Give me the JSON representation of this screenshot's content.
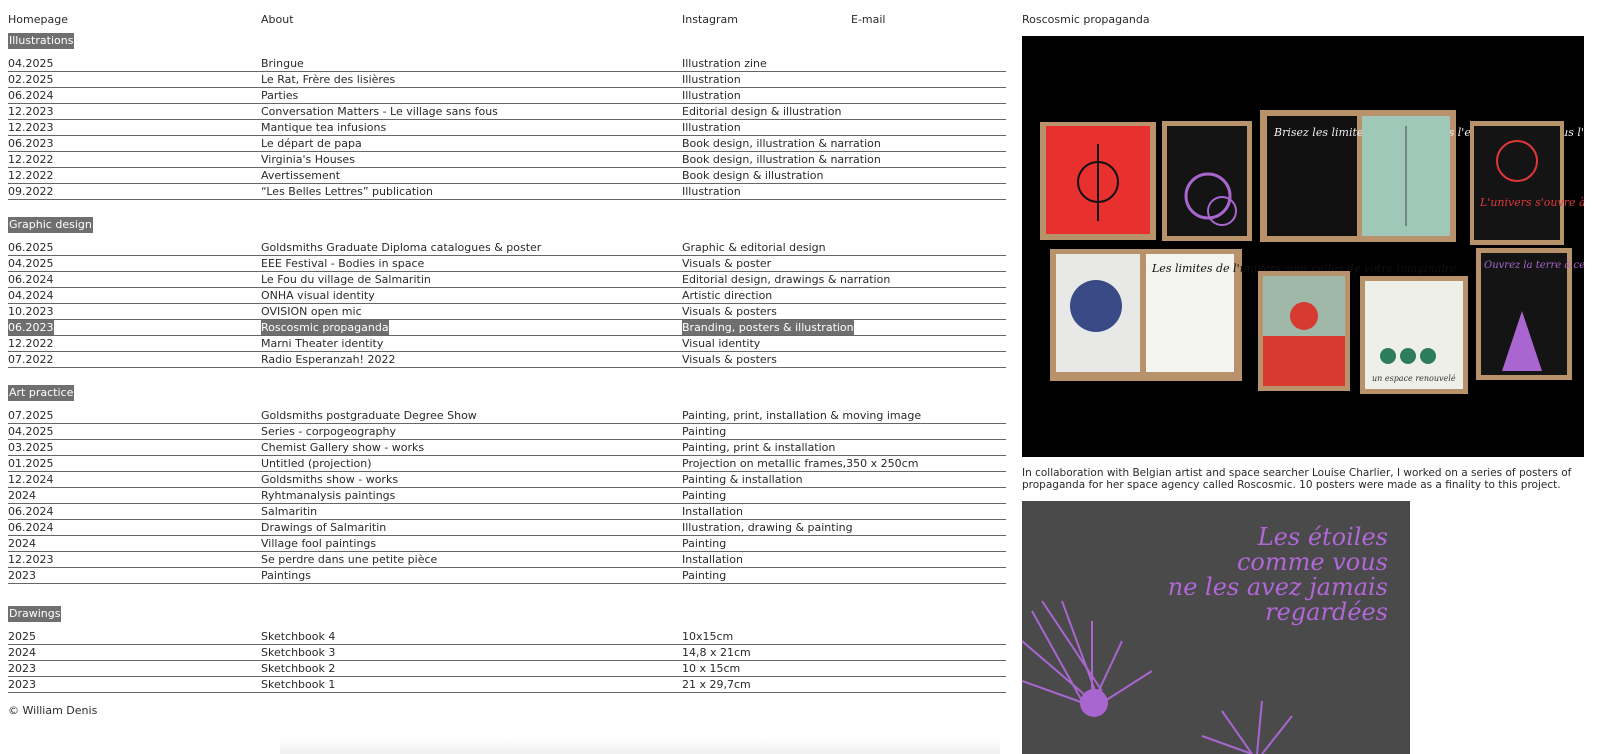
{
  "nav": {
    "homepage": "Homepage",
    "about": "About",
    "instagram": "Instagram",
    "email": "E-mail"
  },
  "right_title": "Roscosmic propaganda",
  "sections": {
    "illustrations": {
      "label": "Illustrations",
      "rows": [
        [
          "04.2025",
          "Bringue",
          "Illustration zine"
        ],
        [
          "02.2025",
          "Le Rat, Frère des lisières",
          "Illustration"
        ],
        [
          "06.2024",
          "Parties",
          "Illustration"
        ],
        [
          "12.2023",
          "Conversation Matters - Le village sans fous",
          "Editorial design & illustration"
        ],
        [
          "12.2023",
          "Mantique tea infusions",
          "Illustration"
        ],
        [
          "06.2023",
          "Le départ de papa",
          "Book design, illustration & narration"
        ],
        [
          "12.2022",
          "Virginia's Houses",
          "Book design, illustration & narration"
        ],
        [
          "12.2022",
          "Avertissement",
          "Book design & illustration"
        ],
        [
          "09.2022",
          "“Les Belles Lettres” publication",
          "Illustration"
        ]
      ]
    },
    "graphic_design": {
      "label": "Graphic design",
      "rows": [
        [
          "06.2025",
          "Goldsmiths Graduate Diploma  catalogues & poster",
          "Graphic & editorial design"
        ],
        [
          "04.2025",
          "EEE Festival - Bodies in space",
          "Visuals & poster"
        ],
        [
          "06.2024",
          "Le Fou du village de Salmaritin",
          "Editorial design, drawings & narration"
        ],
        [
          "04.2024",
          "ONHA visual identity",
          "Artistic direction"
        ],
        [
          "10.2023",
          "OVISION open mic",
          "Visuals & posters"
        ],
        [
          "06.2023",
          "Roscosmic propaganda",
          "Branding, posters & illustration"
        ],
        [
          "12.2022",
          "Marni Theater identity",
          "Visual identity"
        ],
        [
          "07.2022",
          "Radio Esperanzah! 2022",
          "Visuals & posters"
        ]
      ]
    },
    "art_practice": {
      "label": "Art practice",
      "rows": [
        [
          "07.2025",
          "Goldsmiths postgraduate Degree Show",
          "Painting, print, installation & moving image"
        ],
        [
          "04.2025",
          "Series - corpogeography",
          "Painting"
        ],
        [
          "03.2025",
          "Chemist Gallery show - works",
          "Painting, print & installation"
        ],
        [
          "01.2025",
          "Untitled (projection)",
          "Projection on metallic frames,350 x 250cm"
        ],
        [
          "12.2024",
          "Goldsmiths show - works",
          "Painting & installation"
        ],
        [
          "2024",
          "Ryhtmanalysis paintings",
          "Painting"
        ],
        [
          "06.2024",
          "Salmaritin",
          "Installation"
        ],
        [
          "06.2024",
          "Drawings of Salmaritin",
          "Illustration, drawing & painting"
        ],
        [
          "2024",
          "Village fool paintings",
          "Painting"
        ],
        [
          "12.2023",
          "Se perdre dans une petite pièce",
          "Installation"
        ],
        [
          "2023",
          "Paintings",
          "Painting"
        ]
      ]
    },
    "drawings": {
      "label": "Drawings",
      "rows": [
        [
          "2025",
          "Sketchbook 4",
          "10x15cm"
        ],
        [
          "2024",
          "Sketchbook 3",
          "14,8 x 21cm"
        ],
        [
          "2023",
          "Sketchbook 2",
          "10 x 15cm"
        ],
        [
          "2023",
          "Sketchbook 1",
          "21 x 29,7cm"
        ]
      ]
    }
  },
  "highlighted_row": "Roscosmic propaganda",
  "description": "In collaboration with Belgian artist and space searcher Louise Charlier, I worked on a series of posters of propaganda for her space agency called Roscosmic. 10 posters were made as a finality to this project.",
  "poster_text": [
    "Les étoiles",
    "comme vous",
    "ne les avez jamais",
    "regardées"
  ],
  "posters_grid": [
    [
      "Brisez les limites imposées dans l'espace tel que vous l'imaginez",
      "L'univers s'ouvre à votre imaginaire!"
    ],
    [
      "Les limites de l'univers sont celles de votre imaginaire",
      "Ouvrez la terre à ce qu'il se passe au-dessus d'elle",
      "un espace renouvelé"
    ]
  ],
  "copyright": "© William Denis",
  "colors": {
    "highlight_bg": "#6f6f6f",
    "text": "#2a2a2a",
    "poster_purple": "#b267d8"
  }
}
